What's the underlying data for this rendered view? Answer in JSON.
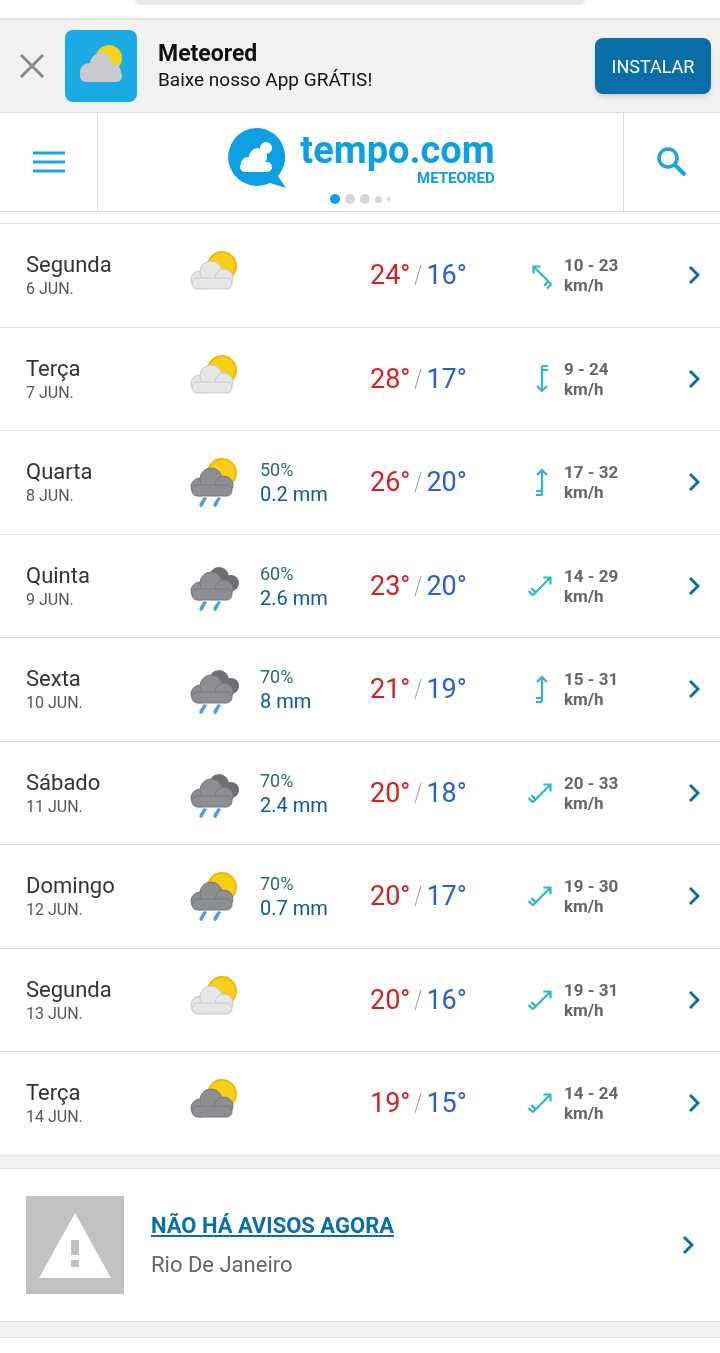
{
  "app_banner": {
    "app_name": "Meteored",
    "tagline": "Baixe nosso App GRÁTIS!",
    "install_label": "INSTALAR"
  },
  "header": {
    "logo_text": "tempo.com",
    "logo_subtext": "METEORED",
    "carousel_dots": [
      {
        "selected": true
      },
      {
        "selected": false
      },
      {
        "selected": false
      },
      {
        "selected": false
      },
      {
        "selected": false
      }
    ]
  },
  "days": [
    {
      "day": "Segunda",
      "date": "6 JUN.",
      "kind": "sun_cloud",
      "max": "24°",
      "min": "16°",
      "wind_arrow": {
        "kind": "nw"
      },
      "wind": "10 - 23",
      "wind_unit": "km/h"
    },
    {
      "day": "Terça",
      "date": "7 JUN.",
      "kind": "sun_cloud",
      "max": "28°",
      "min": "17°",
      "wind_arrow": {
        "kind": "s"
      },
      "wind": "9 - 24",
      "wind_unit": "km/h"
    },
    {
      "day": "Quarta",
      "date": "8 JUN.",
      "kind": "sun_rain",
      "rain_chance": "50%",
      "rain_amount": "0.2 mm",
      "max": "26°",
      "min": "20°",
      "wind_arrow": {
        "kind": "n"
      },
      "wind": "17 - 32",
      "wind_unit": "km/h"
    },
    {
      "day": "Quinta",
      "date": "9 JUN.",
      "kind": "rain",
      "rain_chance": "60%",
      "rain_amount": "2.6 mm",
      "max": "23°",
      "min": "20°",
      "wind_arrow": {
        "kind": "ne"
      },
      "wind": "14 - 29",
      "wind_unit": "km/h"
    },
    {
      "day": "Sexta",
      "date": "10 JUN.",
      "kind": "rain",
      "rain_chance": "70%",
      "rain_amount": "8 mm",
      "max": "21°",
      "min": "19°",
      "wind_arrow": {
        "kind": "n"
      },
      "wind": "15 - 31",
      "wind_unit": "km/h"
    },
    {
      "day": "Sábado",
      "date": "11 JUN.",
      "kind": "rain",
      "rain_chance": "70%",
      "rain_amount": "2.4 mm",
      "max": "20°",
      "min": "18°",
      "wind_arrow": {
        "kind": "ne"
      },
      "wind": "20 - 33",
      "wind_unit": "km/h"
    },
    {
      "day": "Domingo",
      "date": "12 JUN.",
      "kind": "sun_rain",
      "rain_chance": "70%",
      "rain_amount": "0.7 mm",
      "max": "20°",
      "min": "17°",
      "wind_arrow": {
        "kind": "ne"
      },
      "wind": "19 - 30",
      "wind_unit": "km/h"
    },
    {
      "day": "Segunda",
      "date": "13 JUN.",
      "kind": "sun_cloud",
      "max": "20°",
      "min": "16°",
      "wind_arrow": {
        "kind": "ne"
      },
      "wind": "19 - 31",
      "wind_unit": "km/h"
    },
    {
      "day": "Terça",
      "date": "14 JUN.",
      "kind": "sun_dark_cloud",
      "max": "19°",
      "min": "15°",
      "wind_arrow": {
        "kind": "ne"
      },
      "wind": "14 - 24",
      "wind_unit": "km/h"
    }
  ],
  "alert": {
    "title": "NÃO HÁ AVISOS AGORA",
    "location": "Rio De Janeiro"
  }
}
